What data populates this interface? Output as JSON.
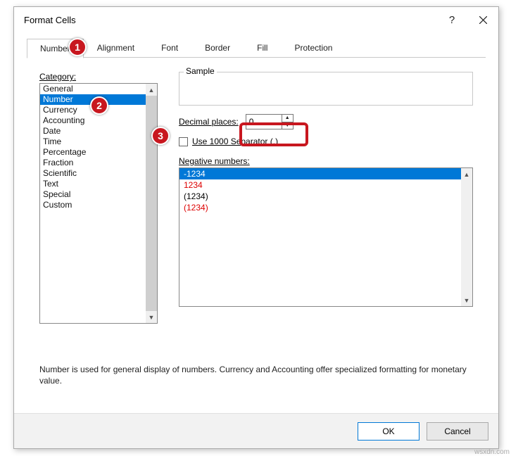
{
  "title": "Format Cells",
  "tabs": [
    "Number",
    "Alignment",
    "Font",
    "Border",
    "Fill",
    "Protection"
  ],
  "active_tab": 0,
  "category_label": "Category:",
  "categories": [
    "General",
    "Number",
    "Currency",
    "Accounting",
    "Date",
    "Time",
    "Percentage",
    "Fraction",
    "Scientific",
    "Text",
    "Special",
    "Custom"
  ],
  "selected_category": 1,
  "sample_label": "Sample",
  "sample_value": "",
  "decimal_label": "Decimal places:",
  "decimal_value": "0",
  "separator_label": "Use 1000 Separator (,)",
  "separator_checked": false,
  "negative_label": "Negative numbers:",
  "negative_numbers": [
    {
      "text": "-1234",
      "style": "sel"
    },
    {
      "text": "1234",
      "style": "red"
    },
    {
      "text": "(1234)",
      "style": ""
    },
    {
      "text": "(1234)",
      "style": "red"
    }
  ],
  "description": "Number is used for general display of numbers.  Currency and Accounting offer specialized formatting for monetary value.",
  "buttons": {
    "ok": "OK",
    "cancel": "Cancel"
  },
  "badges": [
    "1",
    "2",
    "3"
  ],
  "watermark": "wsxdn.com"
}
